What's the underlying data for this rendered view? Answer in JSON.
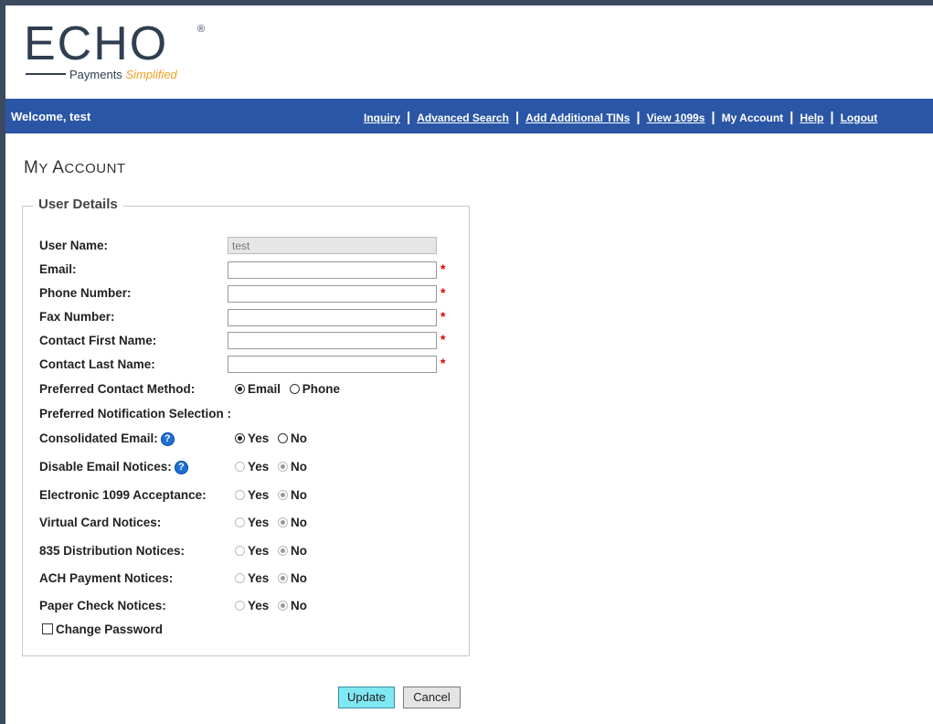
{
  "logo": {
    "name": "ECHO",
    "reg": "®",
    "tagline_prefix": "Payments",
    "tagline_accent": "Simplified"
  },
  "nav": {
    "welcome": "Welcome, test",
    "links": [
      "Inquiry",
      "Advanced Search",
      "Add Additional TINs",
      "View 1099s",
      "My Account",
      "Help",
      "Logout"
    ],
    "separator": "|"
  },
  "page": {
    "title_first": "M",
    "title_rest1": "Y ",
    "title_second": "A",
    "title_rest2": "CCOUNT"
  },
  "form": {
    "legend": "User Details",
    "user_name": {
      "label": "User Name:",
      "value": "test"
    },
    "email": {
      "label": "Email:",
      "value": ""
    },
    "phone": {
      "label": "Phone Number:",
      "value": ""
    },
    "fax": {
      "label": "Fax Number:",
      "value": ""
    },
    "first_name": {
      "label": "Contact First Name:",
      "value": ""
    },
    "last_name": {
      "label": "Contact Last Name:",
      "value": ""
    },
    "required_mark": "*",
    "contact_method": {
      "label": "Preferred Contact Method:",
      "opt1": "Email",
      "opt2": "Phone",
      "selected": "Email"
    },
    "notification_heading": "Preferred Notification Selection :",
    "yes": "Yes",
    "no": "No",
    "help_glyph": "?",
    "consolidated_email": {
      "label": "Consolidated Email:",
      "selected": "Yes"
    },
    "disable_email_notices": {
      "label": "Disable Email Notices:",
      "selected": "No"
    },
    "electronic_1099": {
      "label": "Electronic 1099 Acceptance:",
      "selected": "No"
    },
    "virtual_card": {
      "label": "Virtual Card Notices:",
      "selected": "No"
    },
    "dist_835": {
      "label": "835 Distribution Notices:",
      "selected": "No"
    },
    "ach_payment": {
      "label": "ACH Payment Notices:",
      "selected": "No"
    },
    "paper_check": {
      "label": "Paper Check Notices:",
      "selected": "No"
    },
    "change_password": "Change Password"
  },
  "buttons": {
    "update": "Update",
    "cancel": "Cancel"
  },
  "colors": {
    "navbar": "#2a56a5",
    "update_button": "#7fe8f2",
    "required": "#dd0000",
    "help_icon": "#1e6fd0"
  }
}
